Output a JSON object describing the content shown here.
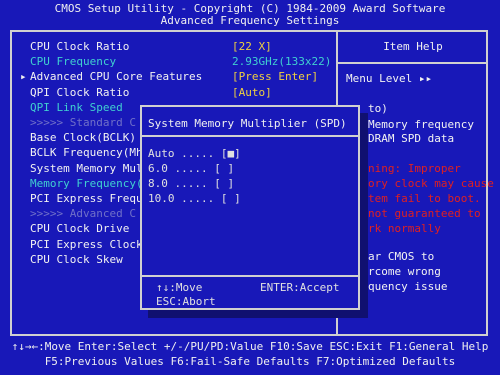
{
  "header": {
    "line1": "CMOS Setup Utility - Copyright (C) 1984-2009 Award Software",
    "line2": "Advanced Frequency Settings"
  },
  "settings": [
    {
      "label": "CPU Clock Ratio",
      "value": "[22 X]",
      "style": "white"
    },
    {
      "label": "CPU Frequency",
      "value": "2.93GHz(133x22)",
      "style": "cyan"
    },
    {
      "label": "Advanced CPU Core Features",
      "value": "[Press Enter]",
      "style": "white",
      "submenu": "▸"
    },
    {
      "label": "QPI Clock Ratio",
      "value": "[Auto]",
      "style": "white"
    },
    {
      "label": "QPI Link Speed",
      "value": "",
      "style": "cyan"
    },
    {
      "label": ">>>>> Standard C",
      "value": "",
      "style": "dim"
    },
    {
      "label": "Base Clock(BCLK)",
      "value": "",
      "style": "white"
    },
    {
      "label": "BCLK Frequency(Mh",
      "value": "",
      "style": "white"
    },
    {
      "label": "System Memory Mul",
      "value": "",
      "style": "white"
    },
    {
      "label": "Memory Frequency(",
      "value": "",
      "style": "cyan"
    },
    {
      "label": "PCI Express Frequ",
      "value": "",
      "style": "white"
    },
    {
      "label": ">>>>> Advanced C",
      "value": "",
      "style": "dim"
    },
    {
      "label": "CPU Clock Drive",
      "value": "",
      "style": "white"
    },
    {
      "label": "PCI Express Clock",
      "value": "",
      "style": "white"
    },
    {
      "label": "CPU Clock Skew",
      "value": "",
      "style": "white"
    }
  ],
  "help": {
    "title": "Item Help",
    "lines": [
      {
        "text": "Menu Level  ▸▸",
        "style": "white"
      },
      {
        "text": "to)",
        "style": "white"
      },
      {
        "text": " Memory frequency",
        "style": "white"
      },
      {
        "text": "DRAM SPD data",
        "style": "white"
      },
      {
        "text": "ning: Improper",
        "style": "red"
      },
      {
        "text": "ory clock may cause",
        "style": "red"
      },
      {
        "text": "tem fail to boot.",
        "style": "red"
      },
      {
        "text": " not guaranteed to",
        "style": "red"
      },
      {
        "text": "rk normally",
        "style": "red"
      },
      {
        "text": "ar CMOS to",
        "style": "white"
      },
      {
        "text": "rcome wrong",
        "style": "white"
      },
      {
        "text": "quency issue",
        "style": "white"
      }
    ]
  },
  "popup": {
    "title": "System Memory Multiplier (SPD)",
    "options": [
      "Auto ..... [■]",
      " 6.0 ..... [ ]",
      " 8.0 ..... [ ]",
      "10.0 ..... [ ]"
    ],
    "move": "↑↓:Move",
    "enter": "ENTER:Accept",
    "esc": "ESC:Abort"
  },
  "footer": {
    "line1": "↑↓→←:Move  Enter:Select  +/-/PU/PD:Value  F10:Save  ESC:Exit  F1:General Help",
    "line2": "F5:Previous Values  F6:Fail-Safe Defaults  F7:Optimized Defaults"
  }
}
